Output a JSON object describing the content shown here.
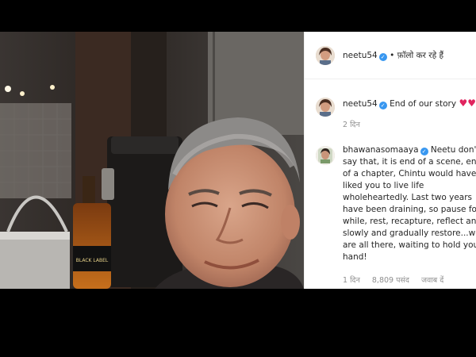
{
  "header": {
    "username": "neetu54",
    "verified_mark": "✓",
    "follow_text": "• फ़ॉलो कर रहे हैं"
  },
  "caption": {
    "username": "neetu54",
    "verified_mark": "✓",
    "text": "End of our story",
    "hearts": "♥♥",
    "time": "2 दिन"
  },
  "comment": {
    "username": "bhawanasomaaya",
    "verified_mark": "✓",
    "lines": [
      "Neetu don't",
      "say that, it is end of a scene, end",
      "of a chapter, Chintu would have",
      "liked you to live life",
      "wholeheartedly. Last two years",
      "have been draining, so pause for a",
      "while, rest, recapture, reflect and",
      "slowly and gradually restore...we",
      "are all there, waiting to hold your",
      "hand!"
    ],
    "time": "1 दिन",
    "likes": "8,809 पसंद",
    "reply": "जवाब दें"
  },
  "photo": {
    "bottle_label": "BLACK LABEL"
  },
  "colors": {
    "verified": "#3897f0",
    "heart": "#e0245e",
    "meta": "#8e8e8e"
  }
}
